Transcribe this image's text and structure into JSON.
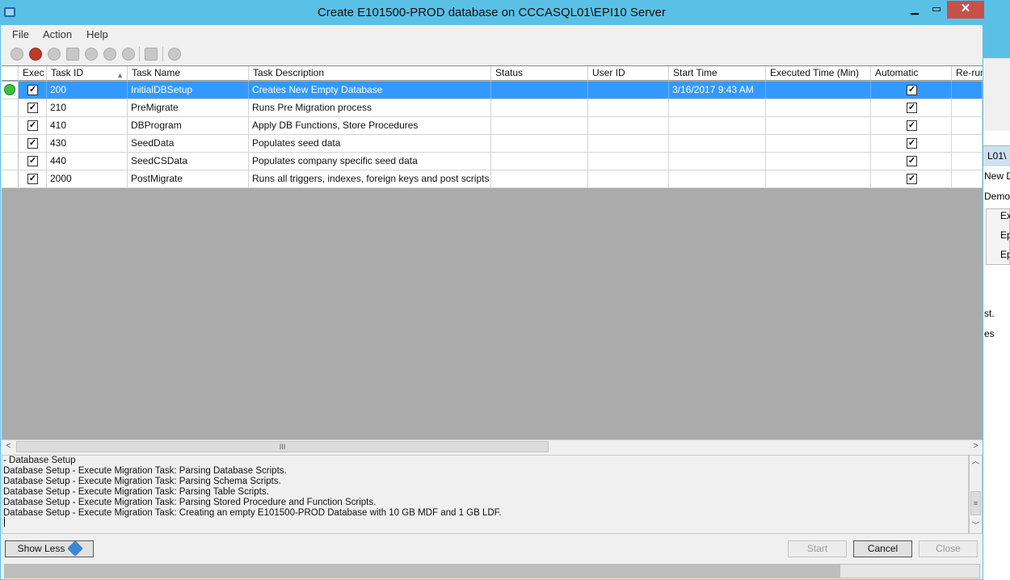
{
  "window": {
    "title": "Create E101500-PROD database on CCCASQL01\\EPI10 Server",
    "minimize": "▁",
    "maximize": "▭",
    "close": "✕"
  },
  "menu": [
    "File",
    "Action",
    "Help"
  ],
  "toolbar_icons": [
    "play-icon",
    "stop-icon",
    "gear-icon",
    "document-icon",
    "check-icon",
    "refresh-icon",
    "info-icon",
    "export-icon",
    "settings-icon"
  ],
  "grid": {
    "columns": [
      "Exec",
      "Task ID",
      "Task Name",
      "Task Description",
      "Status",
      "User ID",
      "Start Time",
      "Executed Time (Min)",
      "Automatic",
      "Re-run"
    ],
    "rows": [
      {
        "exec": true,
        "task_id": "200",
        "task_name": "InitialDBSetup",
        "description": "Creates New Empty Database",
        "status": "",
        "user_id": "",
        "start_time": "3/16/2017 9:43 AM",
        "executed_time": "",
        "automatic": true,
        "selected": true,
        "running": true
      },
      {
        "exec": true,
        "task_id": "210",
        "task_name": "PreMigrate",
        "description": "Runs Pre Migration process",
        "status": "",
        "user_id": "",
        "start_time": "",
        "executed_time": "",
        "automatic": true,
        "selected": false,
        "running": false
      },
      {
        "exec": true,
        "task_id": "410",
        "task_name": "DBProgram",
        "description": "Apply DB Functions, Store Procedures",
        "status": "",
        "user_id": "",
        "start_time": "",
        "executed_time": "",
        "automatic": true,
        "selected": false,
        "running": false
      },
      {
        "exec": true,
        "task_id": "430",
        "task_name": "SeedData",
        "description": "Populates seed data",
        "status": "",
        "user_id": "",
        "start_time": "",
        "executed_time": "",
        "automatic": true,
        "selected": false,
        "running": false
      },
      {
        "exec": true,
        "task_id": "440",
        "task_name": "SeedCSData",
        "description": "Populates company specific seed data",
        "status": "",
        "user_id": "",
        "start_time": "",
        "executed_time": "",
        "automatic": true,
        "selected": false,
        "running": false
      },
      {
        "exec": true,
        "task_id": "2000",
        "task_name": "PostMigrate",
        "description": "Runs all triggers, indexes, foreign keys and post scripts",
        "status": "",
        "user_id": "",
        "start_time": "",
        "executed_time": "",
        "automatic": true,
        "selected": false,
        "running": false
      }
    ],
    "scroll_grip": "III"
  },
  "log": [
    "  - Database Setup",
    "Database Setup - Execute Migration Task: Parsing Database Scripts.",
    "Database Setup - Execute Migration Task: Parsing Schema Scripts.",
    "Database Setup - Execute Migration Task: Parsing Table Scripts.",
    "Database Setup - Execute Migration Task: Parsing Stored Procedure and Function Scripts.",
    "Database Setup - Execute Migration Task: Creating an empty E101500-PROD Database with 10 GB MDF and 1 GB LDF."
  ],
  "buttons": {
    "show_less": "Show Less",
    "start": "Start",
    "cancel": "Cancel",
    "close": "Close"
  },
  "progress": {
    "fraction": 0.857
  },
  "background_window": {
    "fragments": [
      "L01\\",
      "New D",
      "Demo",
      "Exi",
      "Ep",
      "Ep",
      "st.",
      "es"
    ]
  }
}
